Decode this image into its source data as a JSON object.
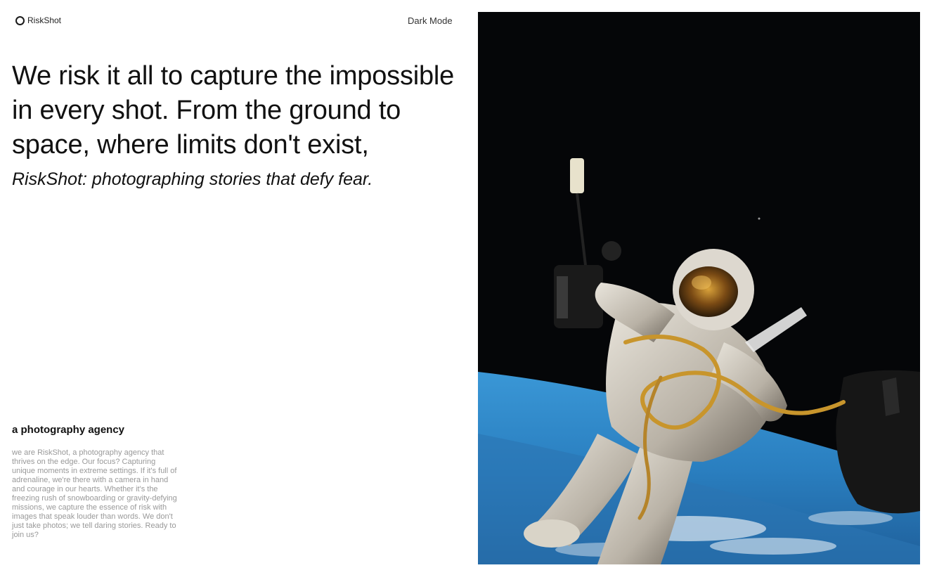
{
  "header": {
    "brand": "RiskShot",
    "dark_mode_label": "Dark Mode"
  },
  "hero": {
    "headline": "We risk it all to capture the impossible in every shot. From the ground to space, where limits don't exist,",
    "tagline": "RiskShot: photographing stories that defy fear."
  },
  "about": {
    "title": "a photography agency",
    "body": "we are RiskShot, a photography agency that thrives on the edge. Our focus? Capturing unique moments in extreme settings. If it's full of adrenaline, we're there with a camera in hand and courage in our hearts. Whether it's the freezing rush of snowboarding or gravity-defying missions, we capture the essence of risk with images that speak louder than words. We don't just take photos; we tell daring stories. Ready to join us?"
  },
  "photo": {
    "subject": "astronaut spacewalk above earth"
  },
  "colors": {
    "text": "#111111",
    "muted": "#999999",
    "background": "#ffffff",
    "space": "#050608",
    "earth": "#2f86c7"
  }
}
